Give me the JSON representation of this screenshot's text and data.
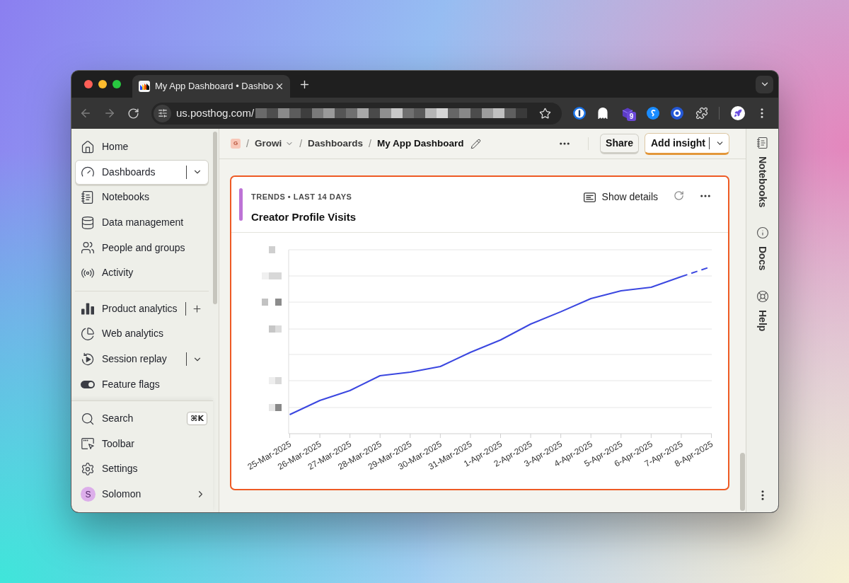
{
  "browser": {
    "tabs": [
      {
        "title": "My App Dashboard • Dashbo",
        "selected": true
      }
    ],
    "address": "us.posthog.com/",
    "extension_badge": "9"
  },
  "sidebar": {
    "sections": [
      {
        "items": [
          {
            "kind": "plain",
            "label": "Home",
            "selected": false
          },
          {
            "kind": "dropdown",
            "label": "Dashboards",
            "selected": true
          },
          {
            "kind": "plain",
            "label": "Notebooks",
            "selected": false
          },
          {
            "kind": "plain",
            "label": "Data management",
            "selected": false
          },
          {
            "kind": "plain",
            "label": "People and groups",
            "selected": false
          },
          {
            "kind": "plain",
            "label": "Activity",
            "selected": false
          }
        ]
      },
      {
        "items": [
          {
            "kind": "add",
            "label": "Product analytics",
            "selected": false
          },
          {
            "kind": "plain",
            "label": "Web analytics",
            "selected": false
          },
          {
            "kind": "dropdown",
            "label": "Session replay",
            "selected": false
          },
          {
            "kind": "plain",
            "label": "Feature flags",
            "selected": false
          }
        ]
      }
    ],
    "footer": {
      "items": [
        {
          "label": "Search",
          "shortcut": "⌘K"
        },
        {
          "label": "Toolbar"
        },
        {
          "label": "Settings"
        }
      ],
      "user": {
        "initial": "S",
        "name": "Solomon"
      }
    }
  },
  "header": {
    "breadcrumbs": [
      {
        "kind": "project",
        "label": "G"
      },
      {
        "kind": "dropdown",
        "separator": "/",
        "label": "Growi"
      },
      {
        "kind": "link",
        "separator": "/",
        "label": "Dashboards"
      },
      {
        "kind": "current",
        "separator": "/",
        "label": "My App Dashboard"
      }
    ],
    "buttons": [
      {
        "kind": "secondary",
        "label": "Share"
      },
      {
        "kind": "primary",
        "label": "Add insight"
      }
    ]
  },
  "insight_card": {
    "eyebrow": "TRENDS • LAST 14 DAYS",
    "title": "Creator Profile Visits",
    "details_button": "Show details",
    "chart": {
      "x_labels": [
        "25-Mar-2025",
        "26-Mar-2025",
        "27-Mar-2025",
        "28-Mar-2025",
        "29-Mar-2025",
        "30-Mar-2025",
        "31-Mar-2025",
        "1-Apr-2025",
        "2-Apr-2025",
        "3-Apr-2025",
        "4-Apr-2025",
        "5-Apr-2025",
        "6-Apr-2025",
        "7-Apr-2025",
        "8-Apr-2025"
      ]
    }
  },
  "right_panel": {
    "tabs": [
      {
        "label": "Notebooks"
      },
      {
        "label": "Docs"
      },
      {
        "label": "Help"
      }
    ]
  }
}
